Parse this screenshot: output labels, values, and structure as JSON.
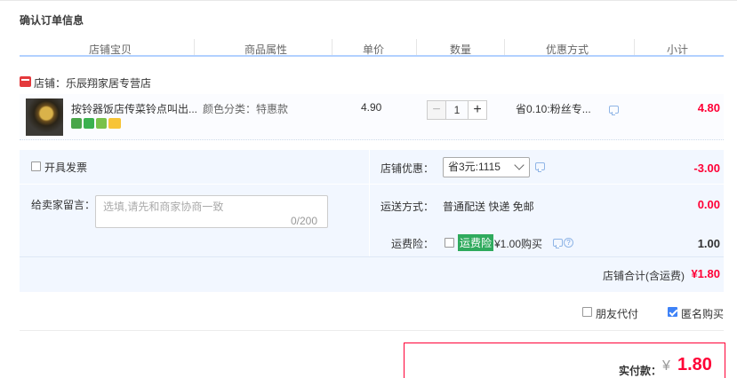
{
  "section_title": "确认订单信息",
  "columns": [
    "店铺宝贝",
    "商品属性",
    "单价",
    "数量",
    "优惠方式",
    "小计"
  ],
  "store": {
    "label": "店铺：乐辰翔家居专营店"
  },
  "item": {
    "name": "按铃器饭店传菜铃点叫出...",
    "attribute": "颜色分类：特惠款",
    "unit_price": "4.90",
    "quantity": "1",
    "minus": "−",
    "plus": "+",
    "promotion": "省0.10:粉丝专...",
    "subtotal": "4.80",
    "badge_icons": [
      "shop-badge-icon",
      "seven-day-return-icon",
      "guarantee-icon",
      "card-pay-icon"
    ]
  },
  "invoice": {
    "label": "开具发票",
    "checked": false
  },
  "store_discount": {
    "label": "店铺优惠：",
    "selected": "省3元:1115",
    "amount": "-3.00"
  },
  "message": {
    "label": "给卖家留言：",
    "placeholder": "选填,请先和商家协商一致",
    "counter": "0/200"
  },
  "shipping": {
    "label": "运送方式：",
    "method": "普通配送 快递 免邮",
    "amount": "0.00"
  },
  "insurance": {
    "label": "运费险：",
    "tag": "运费险",
    "price": "¥1.00购买",
    "amount": "1.00",
    "help": "?"
  },
  "store_total": {
    "label": "店铺合计(含运费)",
    "value": "¥1.80"
  },
  "friend_pay": {
    "label": "朋友代付",
    "checked": false
  },
  "anonymous": {
    "label": "匿名购买",
    "checked": true
  },
  "payment": {
    "label": "实付款：",
    "currency": "¥",
    "amount": "1.80"
  },
  "colors": {
    "accent_red": "#ff0036",
    "header_line": "#b2d1ff",
    "panel_bg": "#f2f7ff",
    "insurance_green": "#2faa5d",
    "check_blue": "#3e82f7"
  }
}
